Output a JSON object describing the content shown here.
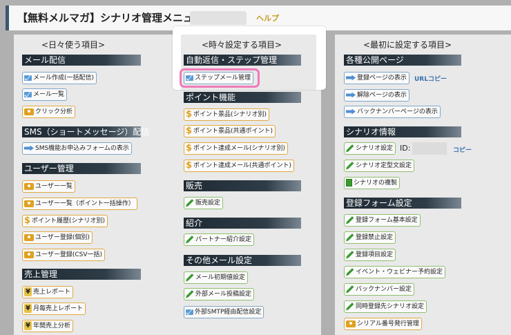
{
  "header": {
    "title": "【無料メルマガ】シナリオ管理メニュー",
    "help": "ヘルプ"
  },
  "columns": {
    "left": {
      "title": "<日々使う項目>",
      "sections": [
        {
          "title": "メール配信",
          "items": [
            "メール作成(一括配信)",
            "メール一覧",
            "クリック分析"
          ]
        },
        {
          "title": "SMS（ショートメッセージ）配信",
          "items": [
            "SMS機能お申込みフォームの表示"
          ]
        },
        {
          "title": "ユーザー管理",
          "items": [
            "ユーザー一覧",
            "ユーザー一覧（ポイント一括操作）",
            "ポイント履歴(シナリオ別)",
            "ユーザー登録(個別)",
            "ユーザー登録(CSV一括)"
          ]
        },
        {
          "title": "売上管理",
          "items": [
            "売上レポート",
            "月毎売上レポート",
            "年間売上分析"
          ]
        }
      ]
    },
    "middle": {
      "title": "<時々設定する項目>",
      "sections": [
        {
          "title": "自動返信・ステップ管理",
          "items": [
            "ステップメール管理"
          ]
        },
        {
          "title": "ポイント機能",
          "items": [
            "ポイント景品(シナリオ別)",
            "ポイント景品(共通ポイント)",
            "ポイント達成メール(シナリオ別)",
            "ポイント達成メール(共通ポイント)"
          ]
        },
        {
          "title": "販売",
          "items": [
            "販売設定"
          ]
        },
        {
          "title": "紹介",
          "items": [
            "パートナー紹介設定"
          ]
        },
        {
          "title": "その他メール設定",
          "items": [
            "メール初期値設定",
            "外部メール投稿設定",
            "外部SMTP経由配信設定"
          ]
        }
      ]
    },
    "right": {
      "title": "<最初に設定する項目>",
      "sections": [
        {
          "title": "各種公開ページ",
          "items": [
            "登録ページの表示",
            "解除ページの表示",
            "バックナンバーページの表示"
          ]
        },
        {
          "title": "シナリオ情報",
          "items": [
            "シナリオ設定",
            "シナリオ定型文設定",
            "シナリオの複製"
          ]
        },
        {
          "title": "登録フォーム設定",
          "items": [
            "登録フォーム基本設定",
            "登録禁止設定",
            "登録項目設定",
            "イベント・ウェビナー予約設定",
            "バックナンバー設定",
            "同時登録先シナリオ設定",
            "シリアル番号発行管理"
          ]
        }
      ],
      "url_copy": "URLコピー",
      "id_label": "ID:",
      "copy": "コピー"
    }
  },
  "colors": {
    "highlight": "#f07ab8",
    "header_accent": "#3d5670",
    "help": "#c89a1c",
    "link": "#3a6fb0"
  }
}
